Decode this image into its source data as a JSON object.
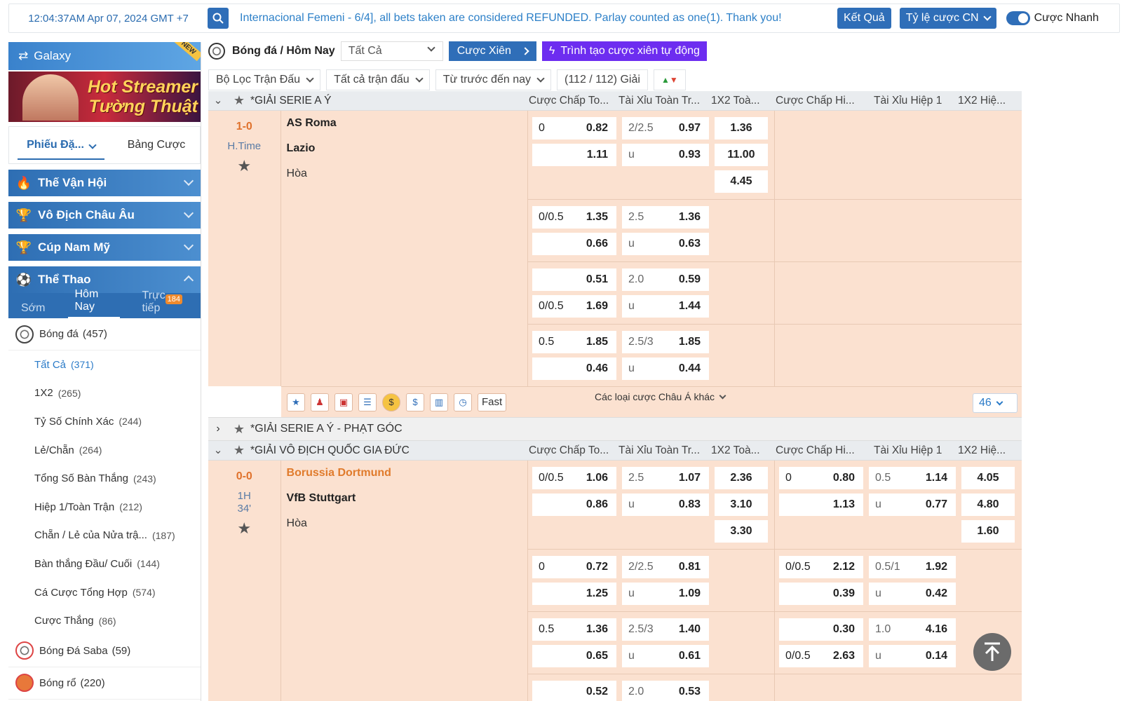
{
  "topbar": {
    "clock": "12:04:37AM Apr 07, 2024 GMT +7",
    "ticker": "Internacional Femeni - 6/4], all bets taken are considered REFUNDED. Parlay counted as one(1). Thank you!",
    "results_label": "Kết Quả",
    "odds_type_label": "Tỷ lệ cược CN",
    "quick_bet_label": "Cược Nhanh"
  },
  "sidebar": {
    "galaxy": "Galaxy",
    "new_badge": "NEW",
    "banner_line1": "Hot Streamer",
    "banner_line2": "Tường Thuật",
    "tab_slip": "Phiếu Đặ...",
    "tab_table": "Bảng Cược",
    "sections": [
      "Thế Vận Hội",
      "Vô Địch Châu Âu",
      "Cúp Nam Mỹ",
      "Thể Thao"
    ],
    "subtabs": {
      "early": "Sớm",
      "today": "Hôm Nay",
      "live": "Trực tiếp",
      "live_count": "184"
    },
    "football": {
      "label": "Bóng đá",
      "count": "(457)"
    },
    "items": [
      {
        "label": "Tất Cả",
        "count": "(371)"
      },
      {
        "label": "1X2",
        "count": "(265)"
      },
      {
        "label": "Tỷ Số Chính Xác",
        "count": "(244)"
      },
      {
        "label": "Lẻ/Chẵn",
        "count": "(264)"
      },
      {
        "label": "Tổng Số Bàn Thắng",
        "count": "(243)"
      },
      {
        "label": "Hiệp 1/Toàn Trận",
        "count": "(212)"
      },
      {
        "label": "Chẵn / Lẻ của Nửa trậ...",
        "count": "(187)"
      },
      {
        "label": "Bàn thắng Đầu/ Cuối",
        "count": "(144)"
      },
      {
        "label": "Cá Cược Tổng Hợp",
        "count": "(574)"
      },
      {
        "label": "Cược Thắng",
        "count": "(86)"
      }
    ],
    "saba": {
      "label": "Bóng Đá Saba",
      "count": "(59)"
    },
    "basket": {
      "label": "Bóng rổ",
      "count": "(220)"
    }
  },
  "main": {
    "crumb": "Bóng đá / Hôm Nay",
    "select_all": "Tất Cả",
    "parlay": "Cược Xiên",
    "auto_parlay": "Trình tạo cược xiên tự động",
    "filters": [
      "Bộ Lọc Trận Đấu",
      "Tất cả trận đấu",
      "Từ trước đến nay"
    ],
    "league_count": "(112 / 112) Giải",
    "cols": [
      "Cược Chấp To...",
      "Tài Xỉu Toàn Tr...",
      "1X2 Toà...",
      "Cược Chấp Hi...",
      "Tài Xỉu Hiệp 1",
      "1X2 Hiệ..."
    ],
    "league1": "*GIẢI SERIE A Ý",
    "league2": "*GIẢI SERIE A Ý - PHẠT GÓC",
    "league3": "*GIẢI VÔ ĐỊCH QUỐC GIA ĐỨC",
    "more_label": "Các loại cược Châu Á khác",
    "more_count": "46",
    "fast": "Fast",
    "match1": {
      "score": "1-0",
      "time": "H.Time",
      "home": "AS Roma",
      "away": "Lazio",
      "draw": "Hòa",
      "g1": {
        "h1": "0",
        "p1": "0.82",
        "h2": "",
        "p2": "1.11",
        "o1": "2/2.5",
        "op1": "0.97",
        "o2": "u",
        "op2": "0.93",
        "x1": "1.36",
        "x2": "11.00",
        "x3": "4.45"
      },
      "g2": {
        "h1": "0/0.5",
        "p1": "1.35",
        "h2": "",
        "p2": "0.66",
        "o1": "2.5",
        "op1": "1.36",
        "o2": "u",
        "op2": "0.63"
      },
      "g3": {
        "h1": "",
        "p1": "0.51",
        "h2": "0/0.5",
        "p2": "1.69",
        "o1": "2.0",
        "op1": "0.59",
        "o2": "u",
        "op2": "1.44"
      },
      "g4": {
        "h1": "0.5",
        "p1": "1.85",
        "h2": "",
        "p2": "0.46",
        "o1": "2.5/3",
        "op1": "1.85",
        "o2": "u",
        "op2": "0.44"
      }
    },
    "match2": {
      "score": "0-0",
      "time1": "1H",
      "time2": "34'",
      "home": "Borussia Dortmund",
      "away": "VfB Stuttgart",
      "draw": "Hòa",
      "g1": {
        "h1": "0/0.5",
        "p1": "1.06",
        "h2": "",
        "p2": "0.86",
        "o1": "2.5",
        "op1": "1.07",
        "o2": "u",
        "op2": "0.83",
        "x1": "2.36",
        "x2": "3.10",
        "x3": "3.30",
        "hh1": "0",
        "hp1": "0.80",
        "hh2": "",
        "hp2": "1.13",
        "ho1": "0.5",
        "hop1": "1.14",
        "ho2": "u",
        "hop2": "0.77",
        "hx1": "4.05",
        "hx2": "4.80",
        "hx3": "1.60"
      },
      "g2": {
        "h1": "0",
        "p1": "0.72",
        "h2": "",
        "p2": "1.25",
        "o1": "2/2.5",
        "op1": "0.81",
        "o2": "u",
        "op2": "1.09",
        "hh1": "0/0.5",
        "hp1": "2.12",
        "hh2": "",
        "hp2": "0.39",
        "ho1": "0.5/1",
        "hop1": "1.92",
        "ho2": "u",
        "hop2": "0.42"
      },
      "g3": {
        "h1": "0.5",
        "p1": "1.36",
        "h2": "",
        "p2": "0.65",
        "o1": "2.5/3",
        "op1": "1.40",
        "o2": "u",
        "op2": "0.61",
        "hh1": "",
        "hp1": "0.30",
        "hh2": "0/0.5",
        "hp2": "2.63",
        "ho1": "1.0",
        "hop1": "4.16",
        "ho2": "u",
        "hop2": "0.14"
      },
      "g4": {
        "h1": "",
        "p1": "0.52",
        "o1": "2.0",
        "op1": "0.53"
      }
    }
  }
}
